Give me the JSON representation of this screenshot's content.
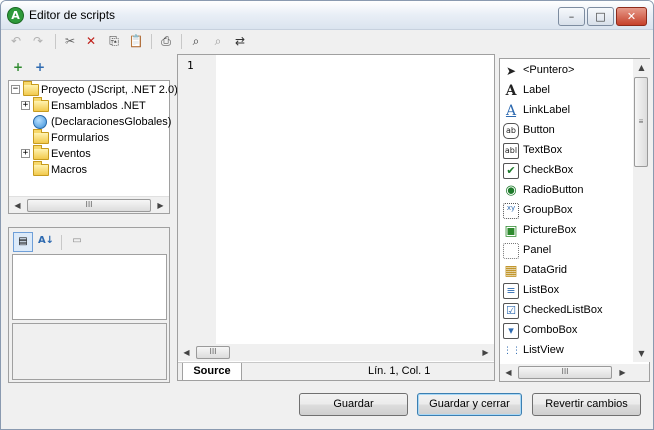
{
  "window": {
    "title": "Editor de scripts",
    "app_icon_glyph": "A",
    "controls": {
      "minimize": "–",
      "maximize": "□",
      "close": "✕"
    }
  },
  "toolbar": {
    "undo_icon": "↶",
    "redo_icon": "↷",
    "cut_icon": "✂",
    "delete_icon": "✕",
    "copy_icon": "⎘",
    "paste_icon": "📋",
    "print_icon": "⎙",
    "find_icon": "⌕",
    "find_next_icon": "⌕",
    "replace_icon": "⇄"
  },
  "project_toolbar": {
    "add_icon": "+",
    "add_form_icon": "+"
  },
  "project_tree": {
    "items": [
      {
        "label": "Proyecto (JScript, .NET 2.0)",
        "expander": "−",
        "icon": "folder-open"
      },
      {
        "label": "Ensamblados .NET",
        "expander": "+",
        "icon": "folder"
      },
      {
        "label": "(DeclaracionesGlobales)",
        "expander": "",
        "icon": "globe"
      },
      {
        "label": "Formularios",
        "expander": "",
        "icon": "folder"
      },
      {
        "label": "Eventos",
        "expander": "+",
        "icon": "folder"
      },
      {
        "label": "Macros",
        "expander": "",
        "icon": "folder"
      }
    ]
  },
  "properties": {
    "categorized_icon": "▤",
    "alphabetical_icon": "A↓",
    "pages_icon": "▭"
  },
  "editor": {
    "line_number": "1",
    "source_tab": "Source",
    "cursor_position": "Lín. 1, Col. 1"
  },
  "toolbox": {
    "items": [
      {
        "label": "<Puntero>",
        "glyph": "➤"
      },
      {
        "label": "Label",
        "glyph": "A"
      },
      {
        "label": "LinkLabel",
        "glyph": "A"
      },
      {
        "label": "Button",
        "glyph": "ab"
      },
      {
        "label": "TextBox",
        "glyph": "abl"
      },
      {
        "label": "CheckBox",
        "glyph": "✔"
      },
      {
        "label": "RadioButton",
        "glyph": "◉"
      },
      {
        "label": "GroupBox",
        "glyph": "xy"
      },
      {
        "label": "PictureBox",
        "glyph": "▣"
      },
      {
        "label": "Panel",
        "glyph": ""
      },
      {
        "label": "DataGrid",
        "glyph": "▦"
      },
      {
        "label": "ListBox",
        "glyph": "≡"
      },
      {
        "label": "CheckedListBox",
        "glyph": "☑"
      },
      {
        "label": "ComboBox",
        "glyph": "▾"
      },
      {
        "label": "ListView",
        "glyph": "⋮⋮"
      }
    ]
  },
  "scroll_glyphs": {
    "left": "◀",
    "right": "▶",
    "up": "▲",
    "down": "▼",
    "grip": "III",
    "vgrip": "≡"
  },
  "buttons": {
    "save": "Guardar",
    "save_close": "Guardar y cerrar",
    "revert": "Revertir cambios"
  }
}
